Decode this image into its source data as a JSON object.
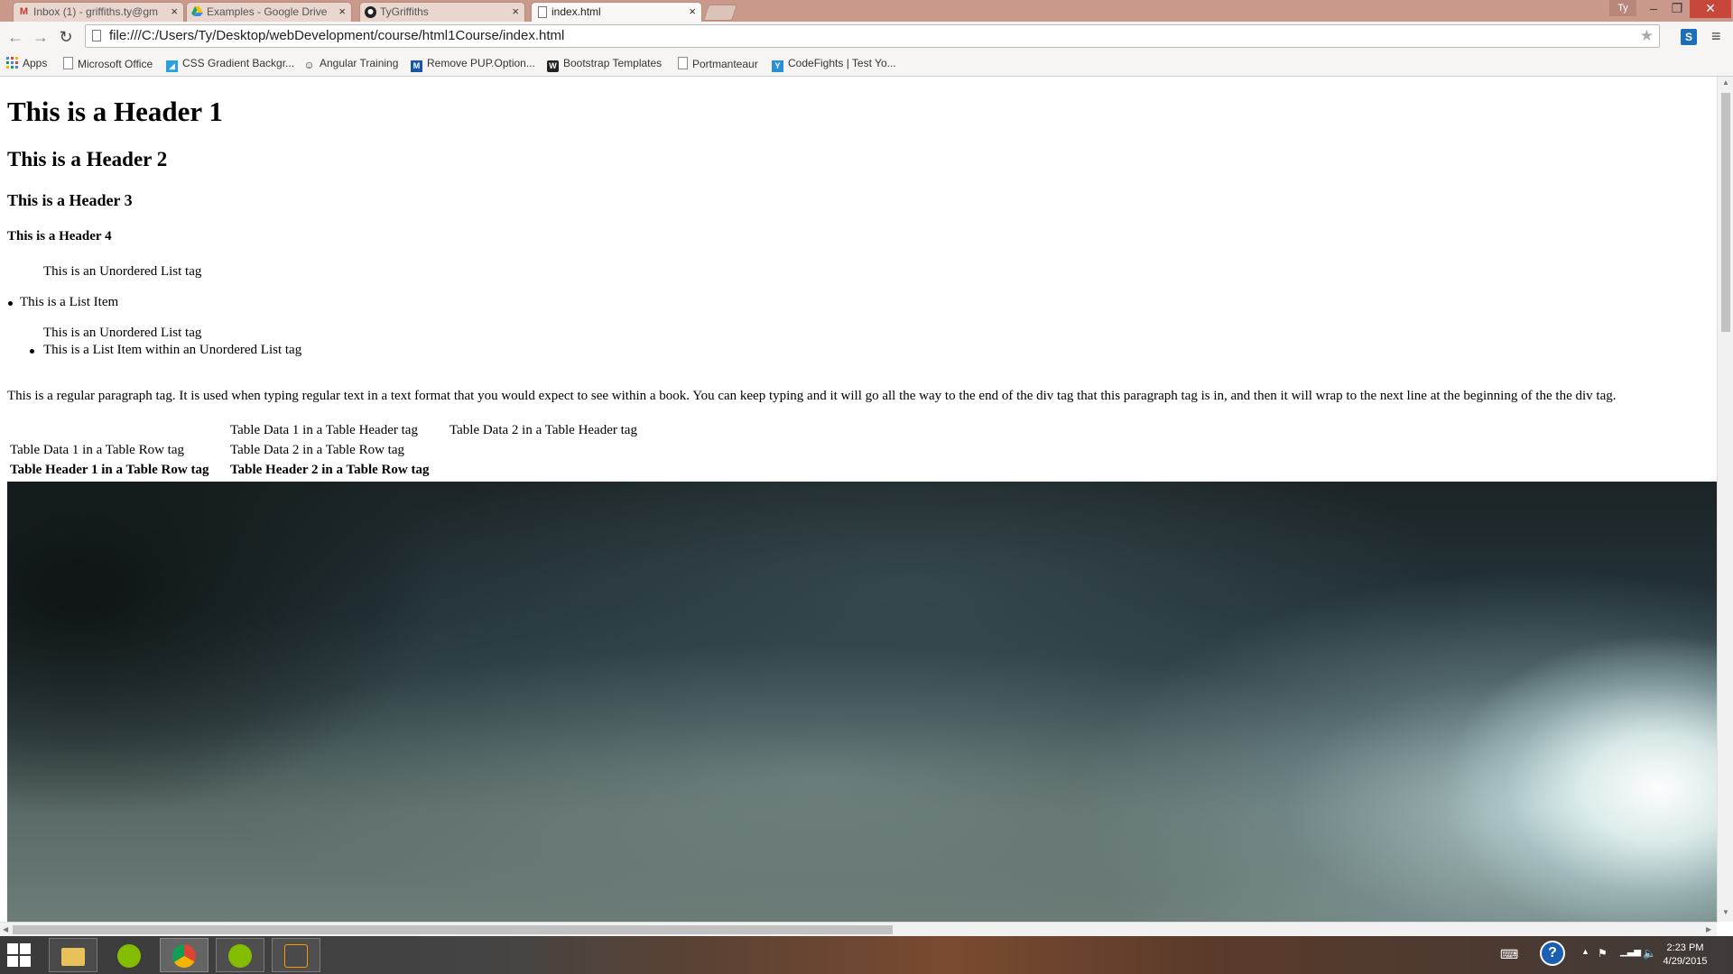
{
  "browser": {
    "tabs": [
      {
        "label": "Inbox (1) - griffiths.ty@gm",
        "icon": "gmail-icon"
      },
      {
        "label": "Examples - Google Drive",
        "icon": "google-drive-icon"
      },
      {
        "label": "TyGriffiths",
        "icon": "github-icon"
      },
      {
        "label": "index.html",
        "icon": "page-icon",
        "active": true
      }
    ],
    "profile": "Ty",
    "url": "file:///C:/Users/Ty/Desktop/webDevelopment/course/html1Course/index.html",
    "bookmarks": [
      {
        "label": "Apps",
        "icon": "apps-grid-icon"
      },
      {
        "label": "Microsoft Office",
        "icon": "page-icon"
      },
      {
        "label": "CSS Gradient Backgr...",
        "icon": "gradient-icon"
      },
      {
        "label": "Angular Training",
        "icon": "angular-icon"
      },
      {
        "label": "Remove PUP.Option...",
        "icon": "malwarebytes-icon"
      },
      {
        "label": "Bootstrap Templates",
        "icon": "wix-icon"
      },
      {
        "label": "Portmanteaur",
        "icon": "page-icon"
      },
      {
        "label": "CodeFights | Test Yo...",
        "icon": "codefights-icon"
      }
    ]
  },
  "page": {
    "h1": "This is a Header 1",
    "h2": "This is a Header 2",
    "h3": "This is a Header 3",
    "h4": "This is a Header 4",
    "ul_text_1": "This is an Unordered List tag",
    "list_item_1": "This is a List Item",
    "ul_text_2": "This is an Unordered List tag",
    "list_item_2": "This is a List Item within an Unordered List tag",
    "paragraph": "This is a regular paragraph tag. It is used when typing regular text in a text format that you would expect to see within a book. You can keep typing and it will go all the way to the end of the div tag that this paragraph tag is in, and then it will wrap to the next line at the beginning of the the div tag.",
    "table": {
      "header_row": [
        "Table Data 1 in a Table Header tag",
        "Table Data 2 in a Table Header tag"
      ],
      "data_row": [
        "Table Data 1 in a Table Row tag",
        "Table Data 2 in a Table Row tag"
      ],
      "bold_row": [
        "Table Header 1 in a Table Row tag",
        "Table Header 2 in a Table Row tag"
      ]
    }
  },
  "taskbar": {
    "apps": [
      "file-explorer-icon",
      "spotify-icon",
      "chrome-icon",
      "spotify-icon",
      "sublime-text-icon"
    ],
    "time": "2:23 PM",
    "date": "4/29/2015"
  }
}
